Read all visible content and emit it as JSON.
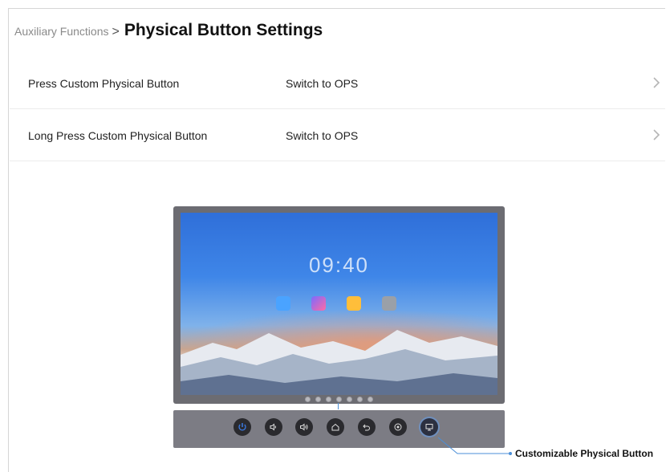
{
  "header": {
    "breadcrumb": "Auxiliary Functions",
    "separator": ">",
    "title": "Physical Button Settings"
  },
  "settings": [
    {
      "label": "Press Custom Physical Button",
      "value": "Switch to OPS"
    },
    {
      "label": "Long Press Custom Physical Button",
      "value": "Switch to OPS"
    }
  ],
  "illustration": {
    "clock": "09:40",
    "callout": "Customizable Physical Button",
    "panel_buttons": [
      "power-icon",
      "volume-down-icon",
      "volume-up-icon",
      "home-icon",
      "back-icon",
      "source-icon",
      "custom-button-icon"
    ],
    "accent_color": "#4b8fd8"
  }
}
